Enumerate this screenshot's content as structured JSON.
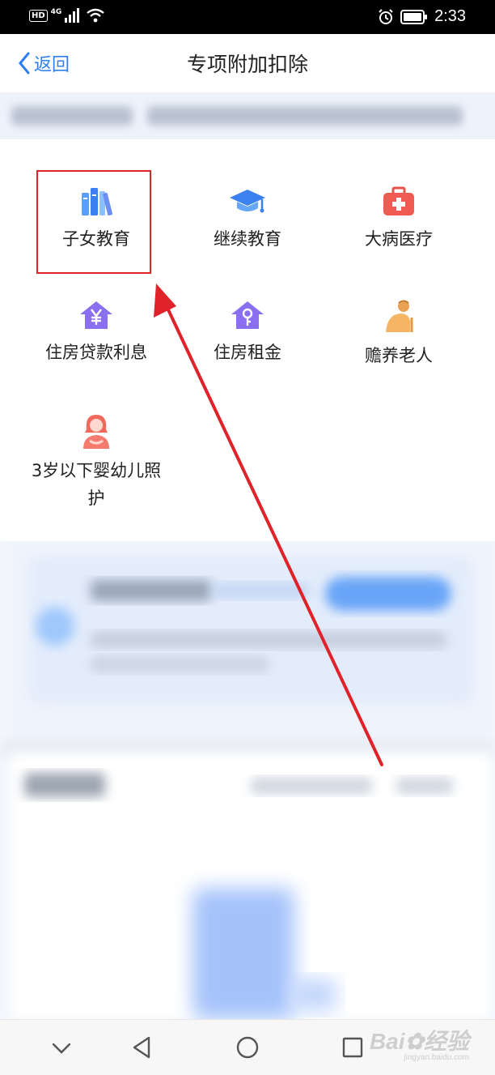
{
  "status_bar": {
    "hd": "HD",
    "network": "4G",
    "time": "2:33"
  },
  "nav": {
    "back_label": "返回",
    "title": "专项附加扣除"
  },
  "items": [
    {
      "label": "子女教育",
      "icon": "books-icon"
    },
    {
      "label": "继续教育",
      "icon": "graduation-cap-icon"
    },
    {
      "label": "大病医疗",
      "icon": "first-aid-kit-icon"
    },
    {
      "label": "住房贷款利息",
      "icon": "house-yuan-icon"
    },
    {
      "label": "住房租金",
      "icon": "house-key-icon"
    },
    {
      "label": "赡养老人",
      "icon": "elderly-person-icon"
    },
    {
      "label": "3岁以下婴幼儿照护",
      "icon": "woman-icon"
    }
  ],
  "watermark": {
    "brand": "Bai",
    "brand_suffix": "经验",
    "url": "jingyan.baidu.com"
  },
  "colors": {
    "accent": "#2d7ff5",
    "highlight": "#e0222a",
    "arrow": "#e0222a"
  }
}
